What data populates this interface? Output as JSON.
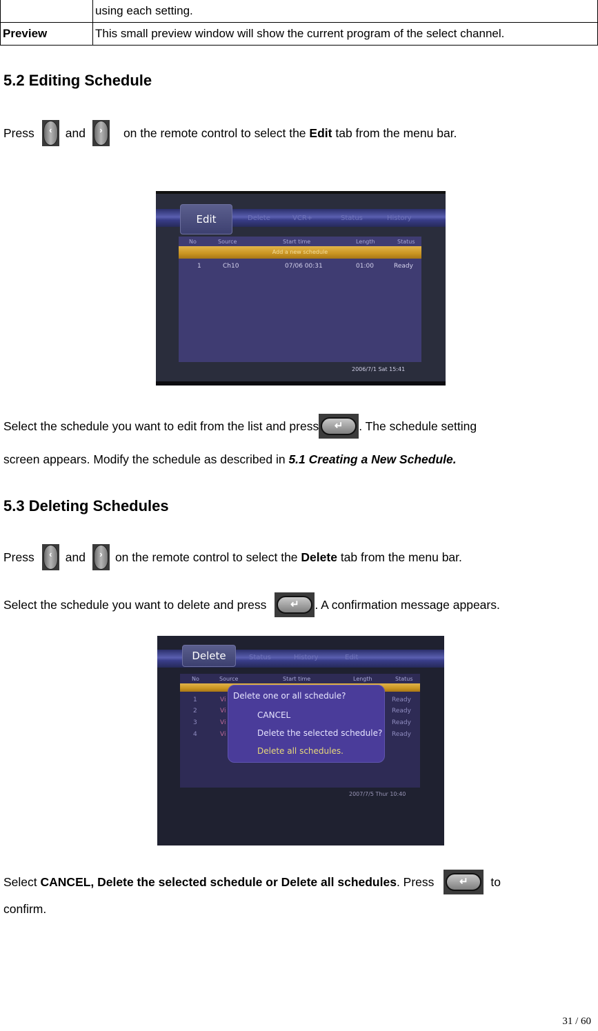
{
  "table": {
    "rows": [
      {
        "label": "",
        "desc": "using each setting."
      },
      {
        "label": "Preview",
        "desc": "This small preview window will show the current program of the select channel."
      }
    ]
  },
  "section_52": {
    "heading": "5.2 Editing Schedule",
    "press_line": {
      "pre": "Press",
      "and": "and",
      "post_a": "on the remote control to select the",
      "bold": "Edit",
      "post_b": "tab from the menu bar."
    },
    "screenshot": {
      "active_tab": "Edit",
      "tabs": [
        "Delete",
        "VCR+",
        "Status",
        "History"
      ],
      "columns": [
        "No",
        "Source",
        "Start time",
        "Length",
        "Status"
      ],
      "highlight_row": "Add a new schedule",
      "rows": [
        {
          "no": "1",
          "source": "Ch10",
          "start": "07/06 00:31",
          "length": "01:00",
          "status": "Ready"
        }
      ],
      "timestamp": "2006/7/1 Sat 15:41"
    },
    "select_line_1_pre": "Select the schedule you want to edit from the list and press",
    "select_line_1_post": ". The schedule setting",
    "select_line_2_pre": "screen appears. Modify the schedule as described in",
    "select_line_2_ref": "5.1 Creating a New Schedule."
  },
  "section_53": {
    "heading": "5.3 Deleting Schedules",
    "press_line": {
      "pre": "Press",
      "and": "and",
      "post_a": "on the remote control to select the",
      "bold": "Delete",
      "post_b": "tab from the menu bar."
    },
    "select_line_pre": "Select the schedule you want to delete and press",
    "select_line_post": ". A confirmation message appears.",
    "screenshot": {
      "active_tab": "Delete",
      "tabs": [
        "Status",
        "History",
        "Edit"
      ],
      "columns": [
        "No",
        "Source",
        "Start time",
        "Length",
        "Status"
      ],
      "rows": [
        {
          "no": "1",
          "source": "Vi",
          "status": "Ready"
        },
        {
          "no": "2",
          "source": "Vi",
          "status": "Ready"
        },
        {
          "no": "3",
          "source": "Vi",
          "status": "Ready"
        },
        {
          "no": "4",
          "source": "Vi",
          "status": "Ready"
        }
      ],
      "dialog": {
        "question": "Delete one or all schedule?",
        "options": [
          "CANCEL",
          "Delete the selected schedule?",
          "Delete all schedules."
        ]
      },
      "timestamp": "2007/7/5 Thur 10:40"
    },
    "final_pre": "Select",
    "final_bold": "CANCEL, Delete the selected schedule or Delete all schedules",
    "final_mid": ". Press",
    "final_post": "to",
    "final_line2": "confirm."
  },
  "icons": {
    "left": "‹",
    "right": "›",
    "enter": "↵"
  },
  "page_number": "31 / 60"
}
